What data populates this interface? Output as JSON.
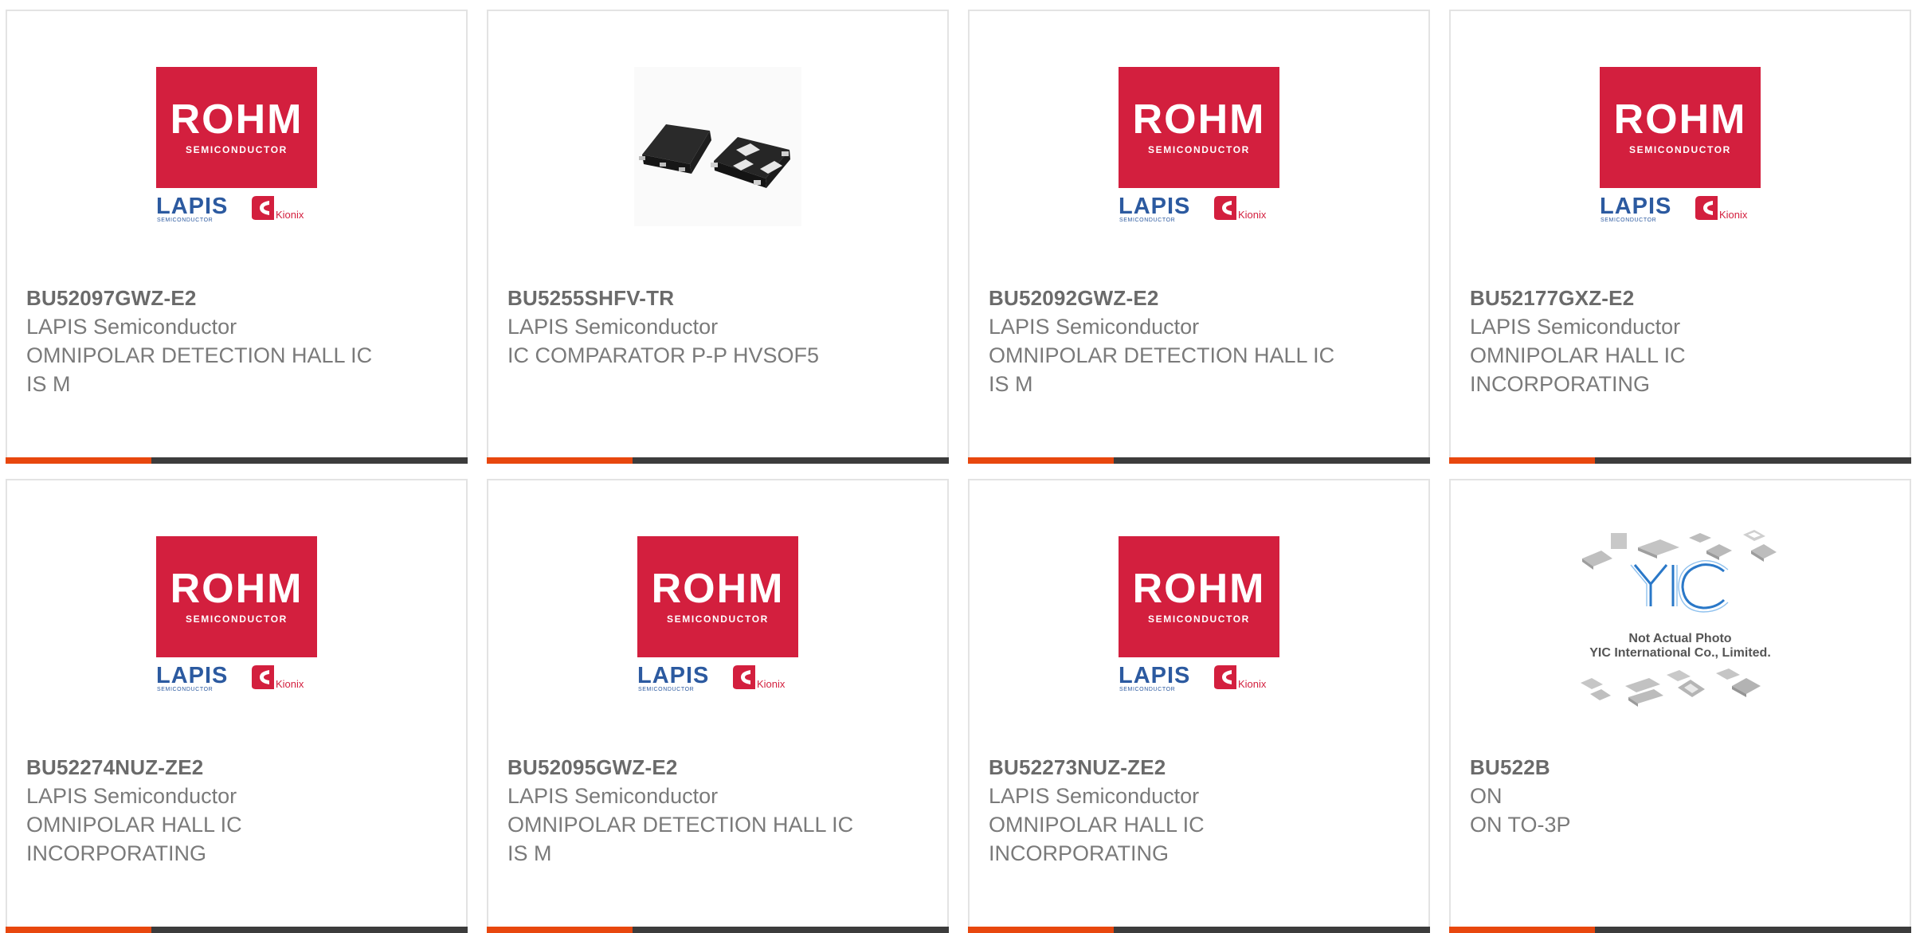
{
  "products": [
    {
      "part": "BU52097GWZ-E2",
      "manufacturer": "LAPIS Semiconductor",
      "description": "OMNIPOLAR DETECTION HALL IC IS M",
      "image": "rohm-lapis-kionix-logo"
    },
    {
      "part": "BU5255SHFV-TR",
      "manufacturer": "LAPIS Semiconductor",
      "description": "IC COMPARATOR P-P HVSOF5",
      "image": "ic-package-photo"
    },
    {
      "part": "BU52092GWZ-E2",
      "manufacturer": "LAPIS Semiconductor",
      "description": "OMNIPOLAR DETECTION HALL IC IS M",
      "image": "rohm-lapis-kionix-logo"
    },
    {
      "part": "BU52177GXZ-E2",
      "manufacturer": "LAPIS Semiconductor",
      "description": "OMNIPOLAR HALL IC INCORPORATING",
      "image": "rohm-lapis-kionix-logo"
    },
    {
      "part": "BU52274NUZ-ZE2",
      "manufacturer": "LAPIS Semiconductor",
      "description": "OMNIPOLAR HALL IC INCORPORATING",
      "image": "rohm-lapis-kionix-logo"
    },
    {
      "part": "BU52095GWZ-E2",
      "manufacturer": "LAPIS Semiconductor",
      "description": "OMNIPOLAR DETECTION HALL IC IS M",
      "image": "rohm-lapis-kionix-logo"
    },
    {
      "part": "BU52273NUZ-ZE2",
      "manufacturer": "LAPIS Semiconductor",
      "description": "OMNIPOLAR HALL IC INCORPORATING",
      "image": "rohm-lapis-kionix-logo"
    },
    {
      "part": "BU522B",
      "manufacturer": "ON",
      "description": "ON TO-3P",
      "image": "yic-not-actual-photo"
    }
  ],
  "logo": {
    "rohm": "ROHM",
    "rohm_sub": "SEMICONDUCTOR",
    "lapis": "LAPIS",
    "lapis_sub": "SEMICONDUCTOR",
    "kionix": "Kionix"
  },
  "placeholder": {
    "line1": "Not Actual Photo",
    "line2": "YIC International Co., Limited."
  },
  "colors": {
    "accent_bar": "#e8470e",
    "dark_bar": "#3c3c3c",
    "rohm_red": "#d31f3e",
    "lapis_blue": "#2c5aa0"
  }
}
